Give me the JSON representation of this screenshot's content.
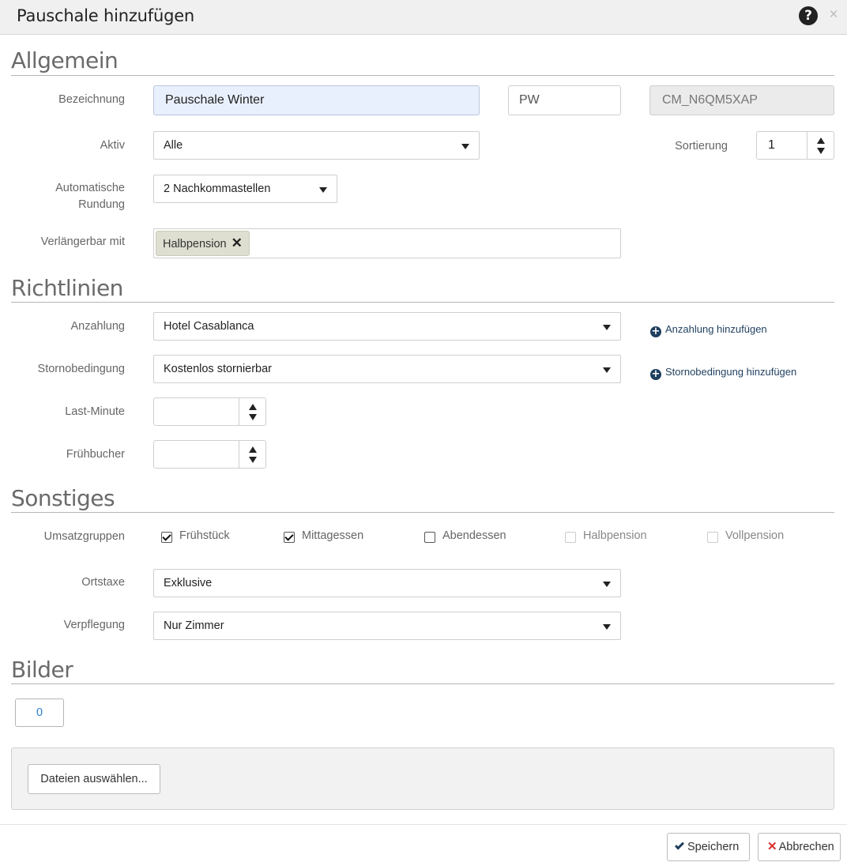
{
  "dialog": {
    "title": "Pauschale hinzufügen",
    "help_icon": "?",
    "close_icon": "×"
  },
  "sections": {
    "allgemein": "Allgemein",
    "richtlinien": "Richtlinien",
    "sonstiges": "Sonstiges",
    "bilder": "Bilder"
  },
  "allgemein": {
    "bezeichnung_label": "Bezeichnung",
    "bezeichnung_value": "Pauschale Winter",
    "kurz_value": "PW",
    "code_value": "CM_N6QM5XAP",
    "aktiv_label": "Aktiv",
    "aktiv_value": "Alle",
    "sortierung_label": "Sortierung",
    "sortierung_value": "1",
    "rundung_label_1": "Automatische",
    "rundung_label_2": "Rundung",
    "rundung_value": "2 Nachkommastellen",
    "verlaengerbar_label": "Verlängerbar mit",
    "verlaengerbar_tag": "Halbpension",
    "tag_remove": "✕"
  },
  "richtlinien": {
    "anzahlung_label": "Anzahlung",
    "anzahlung_value": "Hotel Casablanca",
    "anzahlung_add": "Anzahlung hinzufügen",
    "storno_label": "Stornobedingung",
    "storno_value": "Kostenlos stornierbar",
    "storno_add": "Stornobedingung hinzufügen",
    "lastminute_label": "Last-Minute",
    "lastminute_value": "",
    "fruehbucher_label": "Frühbucher",
    "fruehbucher_value": ""
  },
  "sonstiges": {
    "umsatz_label": "Umsatzgruppen",
    "groups": [
      {
        "label": "Frühstück",
        "checked": true,
        "disabled": false
      },
      {
        "label": "Mittagessen",
        "checked": true,
        "disabled": false
      },
      {
        "label": "Abendessen",
        "checked": false,
        "disabled": false
      },
      {
        "label": "Halbpension",
        "checked": false,
        "disabled": true
      },
      {
        "label": "Vollpension",
        "checked": false,
        "disabled": true
      }
    ],
    "ortstaxe_label": "Ortstaxe",
    "ortstaxe_value": "Exklusive",
    "verpflegung_label": "Verpflegung",
    "verpflegung_value": "Nur Zimmer"
  },
  "bilder": {
    "count": "0",
    "file_button": "Dateien auswählen..."
  },
  "footer": {
    "save": "Speichern",
    "cancel": "Abbrechen"
  }
}
